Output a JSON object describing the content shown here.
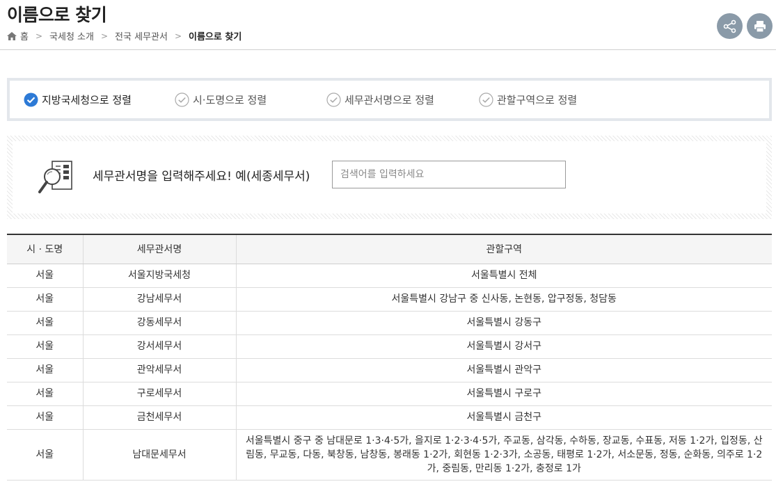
{
  "header": {
    "title": "이름으로 찾기",
    "breadcrumb": [
      "홈",
      "국세청 소개",
      "전국 세무관서",
      "이름으로 찾기"
    ],
    "share_icon": "share-icon",
    "print_icon": "print-icon"
  },
  "sort": {
    "options": [
      "지방국세청으로 정렬",
      "시·도명으로 정렬",
      "세무관서명으로 정렬",
      "관할구역으로 정렬"
    ],
    "selected": "지방국세청으로 정렬"
  },
  "search": {
    "label": "세무관서명을 입력해주세요! 예(세종세무서)",
    "placeholder": "검색어를 입력하세요",
    "value": ""
  },
  "table": {
    "headers": [
      "시 · 도명",
      "세무관서명",
      "관할구역"
    ],
    "rows": [
      [
        "서울",
        "서울지방국세청",
        "서울특별시 전체"
      ],
      [
        "서울",
        "강남세무서",
        "서울특별시 강남구 중 신사동, 논현동, 압구정동, 청담동"
      ],
      [
        "서울",
        "강동세무서",
        "서울특별시 강동구"
      ],
      [
        "서울",
        "강서세무서",
        "서울특별시 강서구"
      ],
      [
        "서울",
        "관악세무서",
        "서울특별시 관악구"
      ],
      [
        "서울",
        "구로세무서",
        "서울특별시 구로구"
      ],
      [
        "서울",
        "금천세무서",
        "서울특별시 금천구"
      ],
      [
        "서울",
        "남대문세무서",
        "서울특별시 중구 중 남대문로 1·3·4·5가, 을지로 1·2·3·4·5가, 주교동, 삼각동, 수하동, 장교동, 수표동, 저동 1·2가, 입정동, 산림동, 무교동, 다동, 북창동, 남창동, 봉래동 1·2가, 회현동 1·2·3가, 소공동, 태평로 1·2가, 서소문동, 정동, 순화동, 의주로 1·2가, 중림동, 만리동 1·2가, 충정로 1가"
      ]
    ]
  }
}
